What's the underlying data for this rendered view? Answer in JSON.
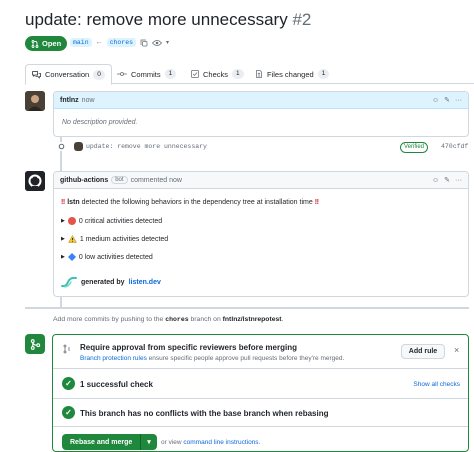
{
  "pr": {
    "title": "update: remove more unnecessary",
    "number": "#2",
    "state": "Open",
    "base_branch": "main",
    "head_branch": "chores"
  },
  "tabs": [
    {
      "label": "Conversation",
      "count": "0"
    },
    {
      "label": "Commits",
      "count": "1"
    },
    {
      "label": "Checks",
      "count": "1"
    },
    {
      "label": "Files changed",
      "count": "1"
    }
  ],
  "comment1": {
    "author": "fntlnz",
    "time": "now",
    "body": "No description provided."
  },
  "commit": {
    "message": "update: remove more unnecessary",
    "status": "Verified",
    "sha": "470cfdf"
  },
  "comment2": {
    "author": "github-actions",
    "badge": "bot",
    "time": "commented now",
    "intro_name": "lstn",
    "intro_text": "detected the following behaviors in the dependency tree at installation time",
    "items": [
      "0 critical activities detected",
      "1 medium activities detected",
      "0 low activities detected"
    ],
    "footer_prefix": "generated by",
    "footer_link": "listen.dev"
  },
  "push_note": {
    "prefix": "Add more commits by pushing to the",
    "branch": "chores",
    "middle": "branch on",
    "repo": "fntlnz/lstnrepotest",
    "suffix": "."
  },
  "merge": {
    "review_title": "Require approval from specific reviewers before merging",
    "review_link": "Branch protection rules",
    "review_desc": "ensure specific people approve pull requests before they're merged.",
    "add_rule": "Add rule",
    "checks_title": "1 successful check",
    "show_checks": "Show all checks",
    "conflicts_title": "This branch has no conflicts with the base branch when rebasing",
    "rebase_button": "Rebase and merge",
    "or_view": "or view",
    "cli_link": "command line instructions",
    "cli_suffix": "."
  },
  "colors": {
    "accent": "#0969da",
    "success": "#1f883d",
    "muted": "#656d76"
  }
}
